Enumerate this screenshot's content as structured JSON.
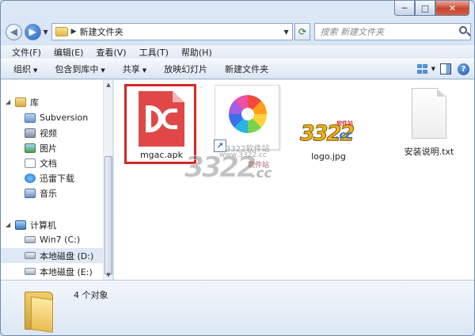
{
  "window": {
    "controls": {
      "minimize": "─",
      "maximize": "□",
      "close": "✕"
    }
  },
  "address": {
    "breadcrumb": "新建文件夹",
    "search_placeholder": "搜索 新建文件夹"
  },
  "menu": [
    "文件(F)",
    "编辑(E)",
    "查看(V)",
    "工具(T)",
    "帮助(H)"
  ],
  "toolbar": {
    "organize": "组织",
    "include_library": "包含到库中",
    "share": "共享",
    "slideshow": "放映幻灯片",
    "new_folder": "新建文件夹"
  },
  "nav": {
    "library": "库",
    "subversion": "Subversion",
    "videos": "视频",
    "pictures": "图片",
    "documents": "文档",
    "thunder": "迅雷下载",
    "music": "音乐",
    "computer": "计算机",
    "win7": "Win7 (C:)",
    "disk_d": "本地磁盘 (D:)",
    "disk_e": "本地磁盘 (E:)"
  },
  "files": [
    {
      "name": "mgac.apk",
      "type": "apk",
      "selected": true
    },
    {
      "name": "",
      "type": "shortcut"
    },
    {
      "name": "logo.jpg",
      "type": "image"
    },
    {
      "name": "安装说明.txt",
      "type": "text"
    }
  ],
  "logo_image": {
    "number": "3322",
    "suffix": ".cc",
    "tag": "软件站"
  },
  "watermark": {
    "line1": "3322软件站",
    "line2": "www.3322.cc",
    "line3": "软件站",
    "big": "3322",
    "cc": ".cc"
  },
  "status": {
    "count": "4 个对象"
  }
}
